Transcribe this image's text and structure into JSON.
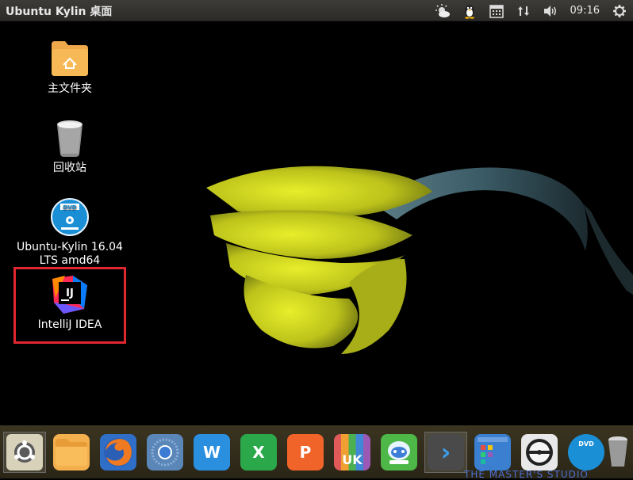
{
  "top_panel": {
    "title": "Ubuntu Kylin 桌面",
    "clock": "09:16",
    "indicators": [
      "weather-icon",
      "qq-penguin-icon",
      "calendar-icon",
      "network-updown-icon",
      "volume-icon"
    ]
  },
  "desktop": {
    "icons": [
      {
        "label": "主文件夹",
        "icon": "home-folder-icon"
      },
      {
        "label": "回收站",
        "icon": "trash-icon"
      },
      {
        "label": "Ubuntu-Kylin 16.04 LTS amd64",
        "line1": "Ubuntu-Kylin 16.04",
        "line2": "LTS amd64",
        "icon": "dvd-icon"
      },
      {
        "label": "IntelliJ IDEA",
        "icon": "intellij-idea-icon",
        "highlighted": true
      }
    ],
    "highlight_color": "#e0262f"
  },
  "dock": {
    "items": [
      {
        "name": "ubuntu-kylin-dash-icon",
        "active": true
      },
      {
        "name": "files-icon"
      },
      {
        "name": "firefox-icon"
      },
      {
        "name": "chromium-icon"
      },
      {
        "name": "wps-writer-icon",
        "glyph": "W"
      },
      {
        "name": "wps-spreadsheets-icon",
        "glyph": "X"
      },
      {
        "name": "wps-presentation-icon",
        "glyph": "P"
      },
      {
        "name": "ubuntu-kylin-software-center-icon",
        "glyph": "UK"
      },
      {
        "name": "youker-assistant-icon"
      },
      {
        "name": "terminal-icon",
        "glyph": "›",
        "active": true
      },
      {
        "name": "workspace-switcher-icon"
      },
      {
        "name": "disk-burner-icon"
      },
      {
        "name": "dvd-drive-icon",
        "glyph": "DVD"
      },
      {
        "name": "trash-dock-icon"
      }
    ]
  },
  "footer_overlay": "THE MASTER'S STUDIO"
}
